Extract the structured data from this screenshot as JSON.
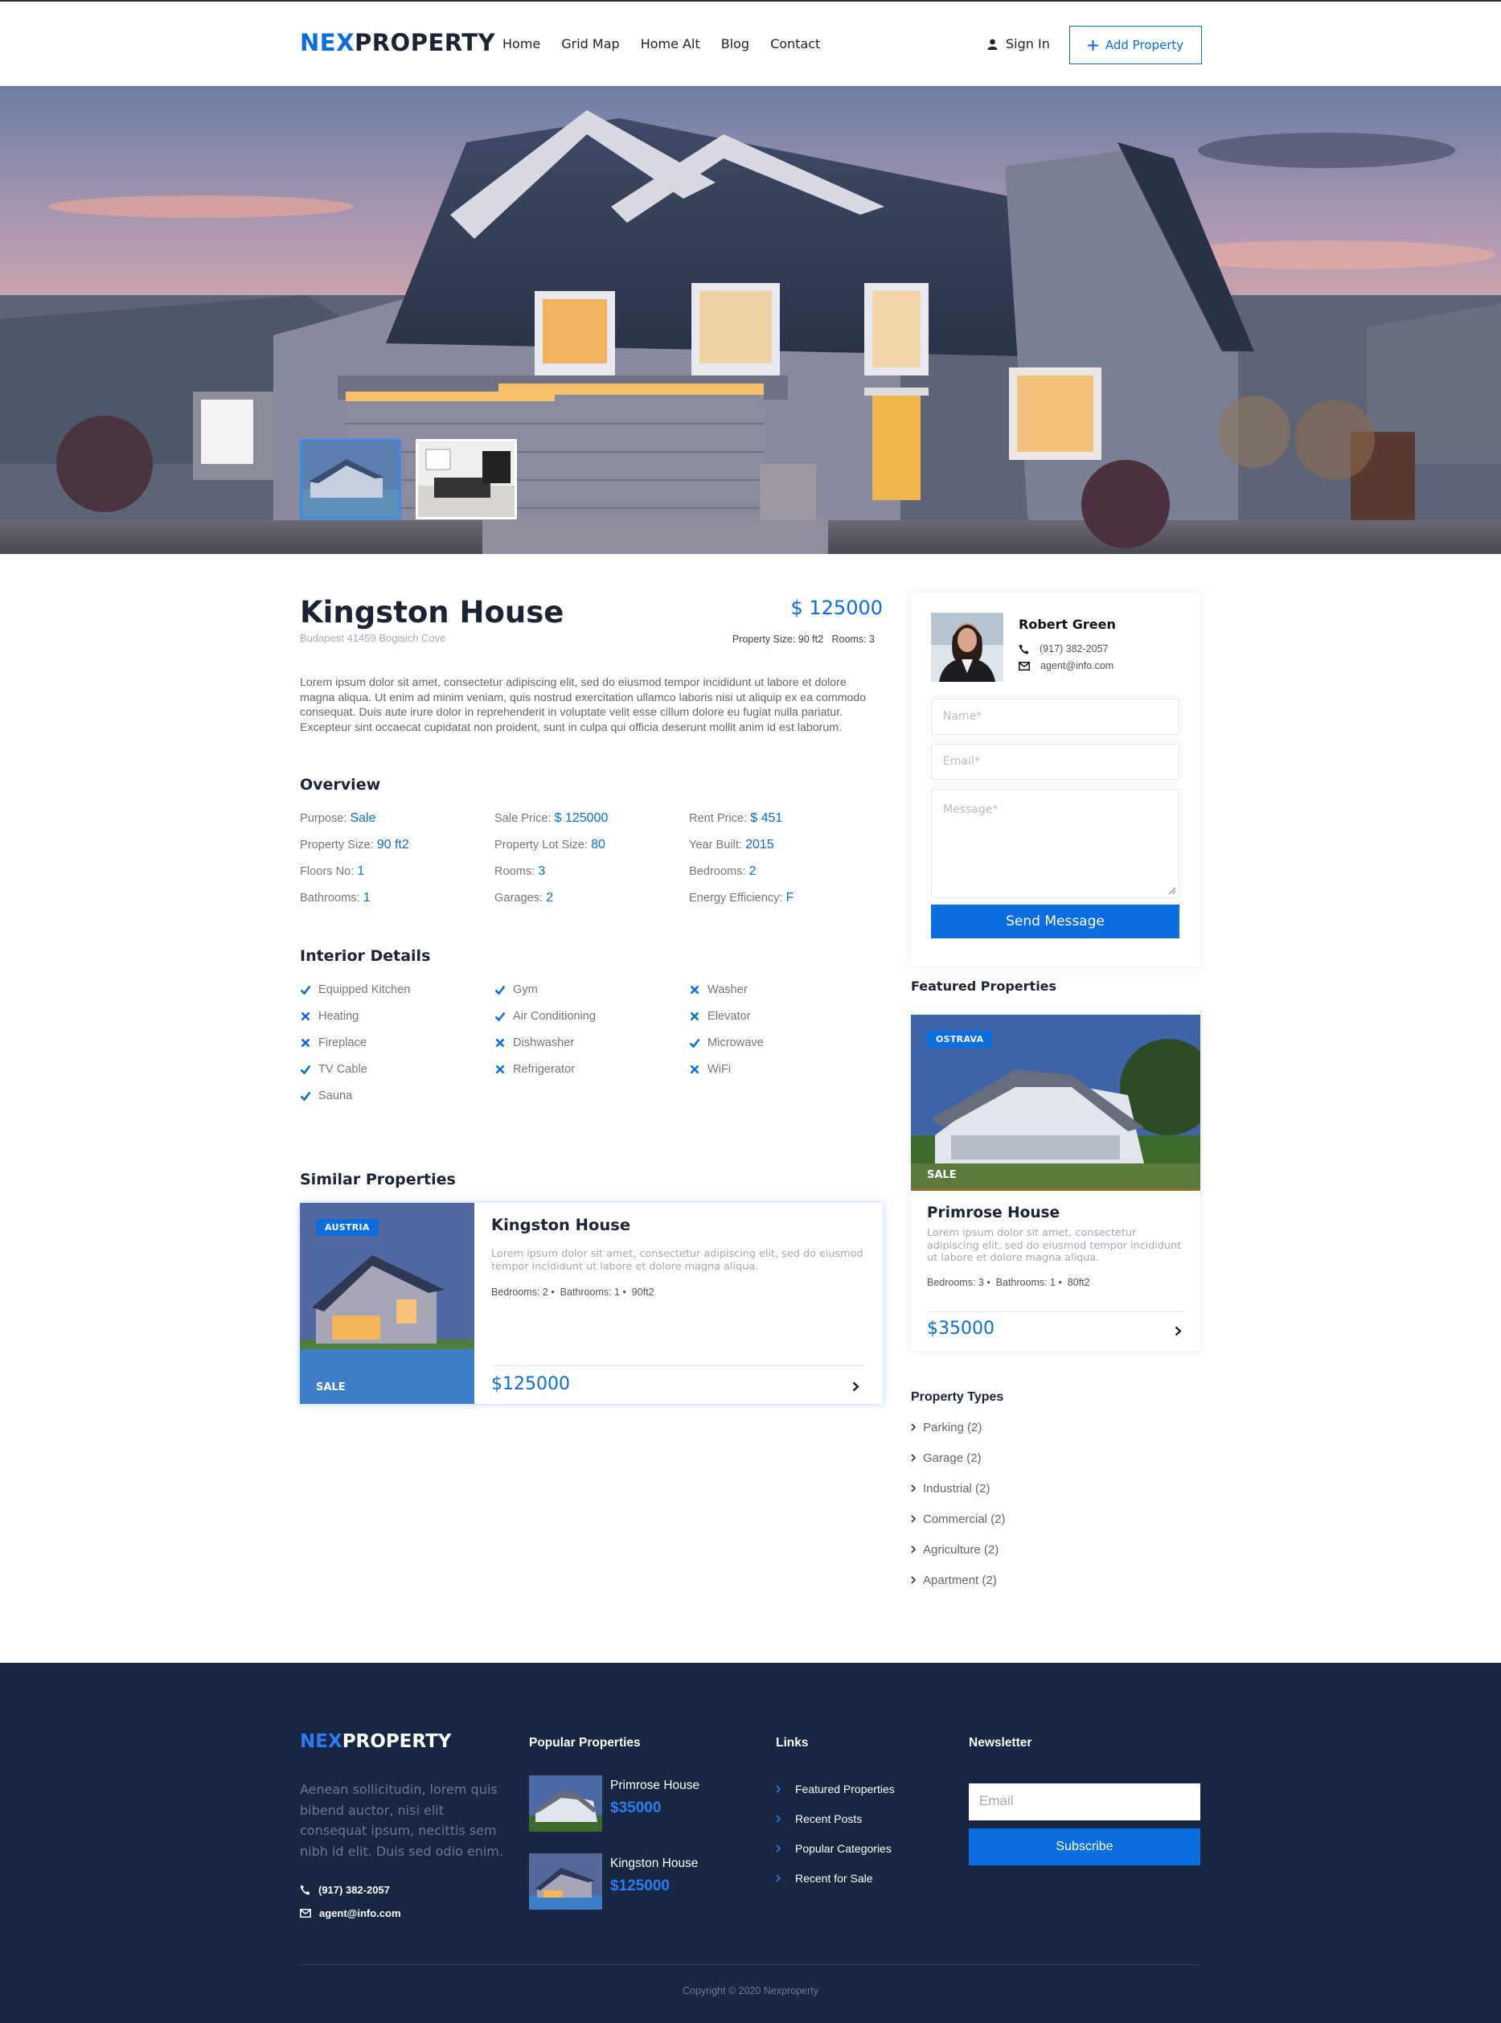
{
  "brand": {
    "part1": "NEX",
    "part2": "PROPERTY"
  },
  "nav": {
    "items": [
      "Home",
      "Grid Map",
      "Home Alt",
      "Blog",
      "Contact"
    ],
    "signin": "Sign In",
    "add_property": "Add Property"
  },
  "property": {
    "title": "Kingston House",
    "address": "Budapest 41459 Bogisich Cove",
    "price": "$ 125000",
    "meta": "Property Size: 90 ft2   Rooms: 3",
    "description": "Lorem ipsum dolor sit amet, consectetur adipiscing elit, sed do eiusmod tempor incididunt ut labore et dolore magna aliqua. Ut enim ad minim veniam, quis nostrud exercitation ullamco laboris nisi ut aliquip ex ea commodo consequat. Duis aute irure dolor in reprehenderit in voluptate velit esse cillum dolore eu fugiat nulla pariatur. Excepteur sint occaecat cupidatat non proident, sunt in culpa qui officia deserunt mollit anim id est laborum."
  },
  "overview": {
    "title": "Overview",
    "items": [
      {
        "label": "Purpose:",
        "value": "Sale"
      },
      {
        "label": "Sale Price:",
        "value": "$ 125000"
      },
      {
        "label": "Rent Price:",
        "value": "$ 451"
      },
      {
        "label": "Property Size:",
        "value": "90 ft2"
      },
      {
        "label": "Property Lot Size:",
        "value": "80"
      },
      {
        "label": "Year Built:",
        "value": "2015"
      },
      {
        "label": "Floors No:",
        "value": "1"
      },
      {
        "label": "Rooms:",
        "value": "3"
      },
      {
        "label": "Bedrooms:",
        "value": "2"
      },
      {
        "label": "Bathrooms:",
        "value": "1"
      },
      {
        "label": "Garages:",
        "value": "2"
      },
      {
        "label": "Energy Efficiency:",
        "value": "F"
      }
    ]
  },
  "interior": {
    "title": "Interior Details",
    "items": [
      {
        "label": "Equipped Kitchen",
        "has": true
      },
      {
        "label": "Gym",
        "has": true
      },
      {
        "label": "Washer",
        "has": false
      },
      {
        "label": "Heating",
        "has": false
      },
      {
        "label": "Air Conditioning",
        "has": true
      },
      {
        "label": "Elevator",
        "has": false
      },
      {
        "label": "Fireplace",
        "has": false
      },
      {
        "label": "Dishwasher",
        "has": false
      },
      {
        "label": "Microwave",
        "has": true
      },
      {
        "label": "TV Cable",
        "has": true
      },
      {
        "label": "Refrigerator",
        "has": false
      },
      {
        "label": "WiFi",
        "has": false
      },
      {
        "label": "Sauna",
        "has": true
      }
    ]
  },
  "similar": {
    "title": "Similar Properties",
    "card": {
      "badge": "AUSTRIA",
      "sale": "SALE",
      "title": "Kingston House",
      "desc": "Lorem ipsum dolor sit amet, consectetur adipiscing elit, sed do eiusmod tempor incididunt ut labore et dolore magna aliqua.",
      "meta": "Bedrooms: 2 •  Bathrooms: 1 •  90ft2",
      "price": "$125000"
    }
  },
  "agent": {
    "name": "Robert Green",
    "phone": "(917) 382-2057",
    "email": "agent@info.com",
    "name_ph": "Name*",
    "email_ph": "Email*",
    "message_ph": "Message*",
    "send": "Send Message"
  },
  "featured": {
    "title": "Featured Properties",
    "card": {
      "badge": "OSTRAVA",
      "sale": "SALE",
      "title": "Primrose House",
      "desc": "Lorem ipsum dolor sit amet, consectetur adipiscing elit, sed do eiusmod tempor incididunt ut labore et dolore magna aliqua.",
      "meta": "Bedrooms: 3 •  Bathrooms: 1 •  80ft2",
      "price": "$35000"
    }
  },
  "types": {
    "title": "Property Types",
    "items": [
      "Parking (2)",
      "Garage (2)",
      "Industrial (2)",
      "Commercial (2)",
      "Agriculture (2)",
      "Apartment (2)"
    ]
  },
  "footer": {
    "about": "Aenean sollicitudin, lorem quis bibend auctor, nisi elit consequat ipsum, necittis sem nibh id elit. Duis sed odio enim.",
    "phone": "(917) 382-2057",
    "email": "agent@info.com",
    "popular_title": "Popular Properties",
    "popular": [
      {
        "title": "Primrose House",
        "price": "$35000"
      },
      {
        "title": "Kingston House",
        "price": "$125000"
      }
    ],
    "links_title": "Links",
    "links": [
      "Featured Properties",
      "Recent Posts",
      "Popular Categories",
      "Recent for Sale"
    ],
    "newsletter_title": "Newsletter",
    "email_ph": "Email",
    "subscribe": "Subscribe",
    "copyright": "Copyright © 2020 Nexproperty"
  },
  "colors": {
    "accent": "#0a6de0",
    "footer_bg": "#172641"
  }
}
